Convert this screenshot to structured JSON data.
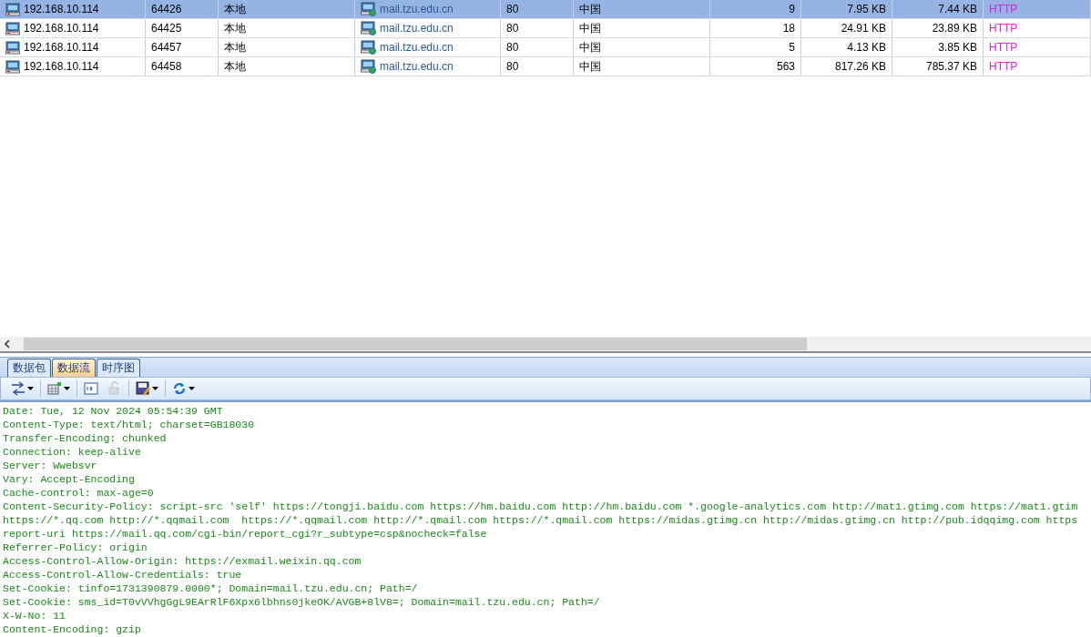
{
  "connections": {
    "rows": [
      {
        "selected": true,
        "cells": [
          "192.168.10.114",
          "64426",
          "本地",
          "mail.tzu.edu.cn",
          "80",
          "中国",
          "9",
          "7.95 KB",
          "7.44 KB",
          "HTTP"
        ]
      },
      {
        "selected": false,
        "cells": [
          "192.168.10.114",
          "64425",
          "本地",
          "mail.tzu.edu.cn",
          "80",
          "中国",
          "18",
          "24.91 KB",
          "23.89 KB",
          "HTTP"
        ]
      },
      {
        "selected": false,
        "cells": [
          "192.168.10.114",
          "64457",
          "本地",
          "mail.tzu.edu.cn",
          "80",
          "中国",
          "5",
          "4.13 KB",
          "3.85 KB",
          "HTTP"
        ]
      },
      {
        "selected": false,
        "cells": [
          "192.168.10.114",
          "64458",
          "本地",
          "mail.tzu.edu.cn",
          "80",
          "中国",
          "563",
          "817.26 KB",
          "785.37 KB",
          "HTTP"
        ]
      }
    ]
  },
  "tabs": [
    {
      "label": "数据包",
      "selected": false
    },
    {
      "label": "数据流",
      "selected": true
    },
    {
      "label": "时序图",
      "selected": false
    }
  ],
  "toolbar": [
    {
      "kind": "arrows",
      "dropdown": true,
      "disabled": false
    },
    {
      "kind": "grid",
      "dropdown": true,
      "disabled": false
    },
    {
      "kind": "hex",
      "dropdown": false,
      "disabled": false
    },
    {
      "kind": "decode",
      "dropdown": false,
      "disabled": true
    },
    {
      "kind": "save",
      "dropdown": true,
      "disabled": false
    },
    {
      "kind": "refresh",
      "dropdown": true,
      "disabled": false
    }
  ],
  "stream_lines": [
    "Date: Tue, 12 Nov 2024 05:54:39 GMT",
    "Content-Type: text/html; charset=GB18030",
    "Transfer-Encoding: chunked",
    "Connection: keep-alive",
    "Server: Wwebsvr",
    "Vary: Accept-Encoding",
    "Cache-control: max-age=0",
    "Content-Security-Policy: script-src 'self' https://tongji.baidu.com https://hm.baidu.com http://hm.baidu.com *.google-analytics.com http://mat1.gtimg.com https://mat1.gtim",
    "https://*.qq.com http://*.qqmail.com  https://*.qqmail.com http://*.qmail.com https://*.qmail.com https://midas.gtimg.cn http://midas.gtimg.cn http://pub.idqqimg.com https",
    "report-uri https://mail.qq.com/cgi-bin/report_cgi?r_subtype=csp&nocheck=false",
    "Referrer-Policy: origin",
    "Access-Control-Allow-Origin: https://exmail.weixin.qq.com",
    "Access-Control-Allow-Credentials: true",
    "Set-Cookie: tinfo=1731390879.0000*; Domain=mail.tzu.edu.cn; Path=/",
    "Set-Cookie: sms_id=T0vVVhgGgL9EArRlF6Xpx6lbhns0jkeOK/AVGB+8lV8=; Domain=mail.tzu.edu.cn; Path=/",
    "X-W-No: 11",
    "Content-Encoding: gzip"
  ]
}
